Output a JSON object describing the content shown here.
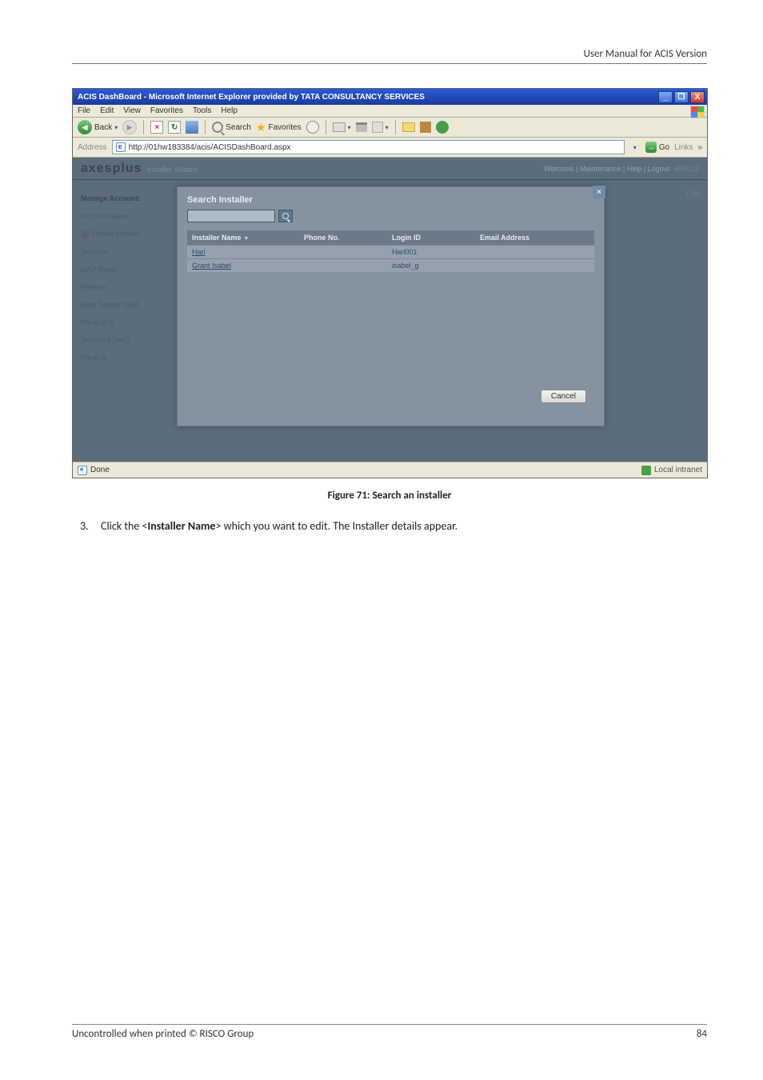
{
  "doc": {
    "header_right": "User Manual for ACIS Version",
    "caption": "Figure 71: Search an installer",
    "step_num": "3.",
    "step_text_1": "Click the <",
    "step_bold": "Installer Name",
    "step_text_2": "> which you want to edit. The Installer details appear.",
    "footer_left": "Uncontrolled when printed © RISCO Group",
    "footer_right": "84"
  },
  "window": {
    "title": "ACIS DashBoard - Microsoft Internet Explorer provided by TATA CONSULTANCY SERVICES",
    "min": "_",
    "max": "❐",
    "close": "X"
  },
  "menubar": {
    "file": "File",
    "edit": "Edit",
    "view": "View",
    "favorites": "Favorites",
    "tools": "Tools",
    "help": "Help"
  },
  "toolbar": {
    "back": "Back",
    "search": "Search",
    "favorites": "Favorites"
  },
  "addressbar": {
    "label": "Address",
    "url": "http://01hw183384/acis/ACISDashBoard.aspx",
    "go": "Go",
    "links": "Links"
  },
  "app": {
    "brand": "axesplus",
    "brand_suffix": "Installer Wizard",
    "hdr_links": "Welcome | Maintenance | Help | Logout",
    "hdr_risco": "RISC@",
    "side": {
      "i1": "Manage Account:",
      "i2": "Account Name",
      "i3": "Create Installer",
      "i4": "Sections",
      "i5": "MAP Panel",
      "i6": "Panel-a",
      "i7": "main Section (Def",
      "i8": "Panel-B-S",
      "i9": "Section 2 (abc)",
      "i10": "Panel-A"
    },
    "right_strip": "Filter"
  },
  "panel": {
    "title": "Search Installer",
    "close": "×",
    "search_value": "",
    "grid": {
      "col_name": "Installer Name",
      "col_phone": "Phone No.",
      "col_login": "Login ID",
      "col_email": "Email Address",
      "rows": [
        {
          "name": "Hari",
          "phone": "",
          "login": "Hari001",
          "email": ""
        },
        {
          "name": "Grant Isabel",
          "phone": "",
          "login": "isabel_g",
          "email": ""
        }
      ]
    },
    "cancel": "Cancel"
  },
  "statusbar": {
    "done": "Done",
    "zone": "Local intranet"
  }
}
